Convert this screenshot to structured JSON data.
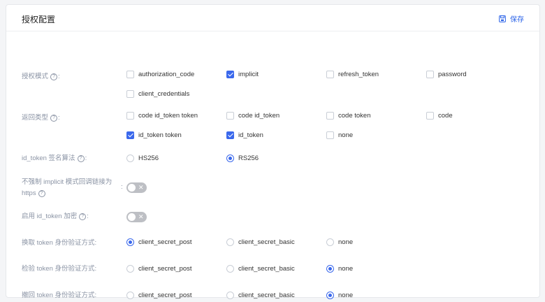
{
  "header": {
    "title": "授权配置",
    "save_label": "保存"
  },
  "rows": {
    "grant_types": {
      "label": "授权模式",
      "options": [
        {
          "label": "authorization_code",
          "checked": false
        },
        {
          "label": "implicit",
          "checked": true
        },
        {
          "label": "refresh_token",
          "checked": false
        },
        {
          "label": "password",
          "checked": false
        },
        {
          "label": "client_credentials",
          "checked": false
        }
      ]
    },
    "response_types": {
      "label": "返回类型",
      "options": [
        {
          "label": "code id_token token",
          "checked": false
        },
        {
          "label": "code id_token",
          "checked": false
        },
        {
          "label": "code token",
          "checked": false
        },
        {
          "label": "code",
          "checked": false
        },
        {
          "label": "id_token token",
          "checked": true
        },
        {
          "label": "id_token",
          "checked": true
        },
        {
          "label": "none",
          "checked": false
        }
      ]
    },
    "id_token_alg": {
      "label": "id_token 签名算法",
      "options": [
        {
          "label": "HS256",
          "selected": false
        },
        {
          "label": "RS256",
          "selected": true
        }
      ]
    },
    "implicit_redirect": {
      "label_line1": "不强制 implicit 模式回调链接为",
      "label_line2": "https",
      "enabled": false,
      "toggle_mark": "✕"
    },
    "id_token_encrypt": {
      "label": "启用 id_token 加密",
      "enabled": false,
      "toggle_mark": "✕"
    },
    "token_auth": {
      "label": "换取 token 身份验证方式",
      "options": [
        {
          "label": "client_secret_post",
          "selected": true
        },
        {
          "label": "client_secret_basic",
          "selected": false
        },
        {
          "label": "none",
          "selected": false
        }
      ]
    },
    "introspect_auth": {
      "label": "检验 token 身份验证方式",
      "options": [
        {
          "label": "client_secret_post",
          "selected": false
        },
        {
          "label": "client_secret_basic",
          "selected": false
        },
        {
          "label": "none",
          "selected": true
        }
      ]
    },
    "revoke_auth": {
      "label": "撤回 token 身份验证方式",
      "options": [
        {
          "label": "client_secret_post",
          "selected": false
        },
        {
          "label": "client_secret_basic",
          "selected": false
        },
        {
          "label": "none",
          "selected": true
        }
      ]
    }
  },
  "help_glyph": "?",
  "colon": ":",
  "colors": {
    "accent": "#3a68ec",
    "label": "#8a93a4",
    "toggle_off": "#bdbfc4"
  }
}
